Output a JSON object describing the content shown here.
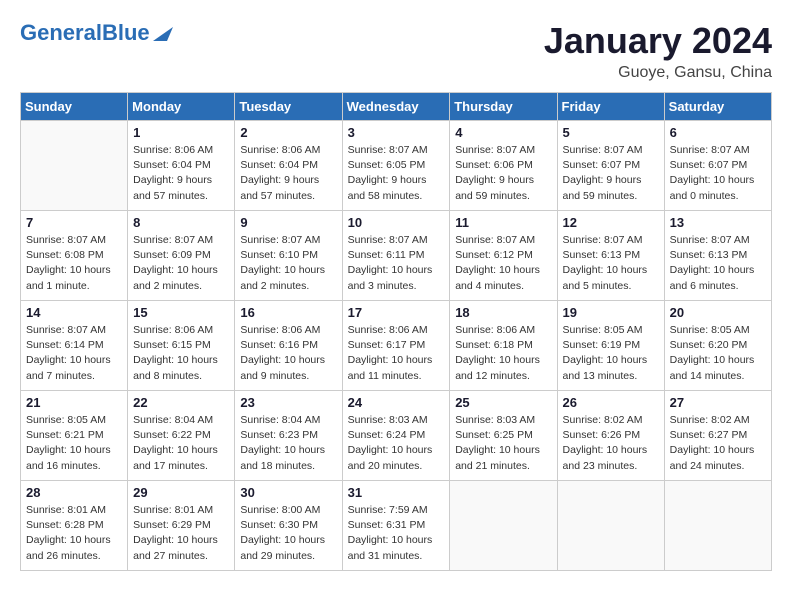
{
  "header": {
    "logo_text_regular": "General",
    "logo_text_blue": "Blue",
    "month_title": "January 2024",
    "location": "Guoye, Gansu, China"
  },
  "days_of_week": [
    "Sunday",
    "Monday",
    "Tuesday",
    "Wednesday",
    "Thursday",
    "Friday",
    "Saturday"
  ],
  "weeks": [
    [
      {
        "day": "",
        "info": ""
      },
      {
        "day": "1",
        "info": "Sunrise: 8:06 AM\nSunset: 6:04 PM\nDaylight: 9 hours\nand 57 minutes."
      },
      {
        "day": "2",
        "info": "Sunrise: 8:06 AM\nSunset: 6:04 PM\nDaylight: 9 hours\nand 57 minutes."
      },
      {
        "day": "3",
        "info": "Sunrise: 8:07 AM\nSunset: 6:05 PM\nDaylight: 9 hours\nand 58 minutes."
      },
      {
        "day": "4",
        "info": "Sunrise: 8:07 AM\nSunset: 6:06 PM\nDaylight: 9 hours\nand 59 minutes."
      },
      {
        "day": "5",
        "info": "Sunrise: 8:07 AM\nSunset: 6:07 PM\nDaylight: 9 hours\nand 59 minutes."
      },
      {
        "day": "6",
        "info": "Sunrise: 8:07 AM\nSunset: 6:07 PM\nDaylight: 10 hours\nand 0 minutes."
      }
    ],
    [
      {
        "day": "7",
        "info": "Sunrise: 8:07 AM\nSunset: 6:08 PM\nDaylight: 10 hours\nand 1 minute."
      },
      {
        "day": "8",
        "info": "Sunrise: 8:07 AM\nSunset: 6:09 PM\nDaylight: 10 hours\nand 2 minutes."
      },
      {
        "day": "9",
        "info": "Sunrise: 8:07 AM\nSunset: 6:10 PM\nDaylight: 10 hours\nand 2 minutes."
      },
      {
        "day": "10",
        "info": "Sunrise: 8:07 AM\nSunset: 6:11 PM\nDaylight: 10 hours\nand 3 minutes."
      },
      {
        "day": "11",
        "info": "Sunrise: 8:07 AM\nSunset: 6:12 PM\nDaylight: 10 hours\nand 4 minutes."
      },
      {
        "day": "12",
        "info": "Sunrise: 8:07 AM\nSunset: 6:13 PM\nDaylight: 10 hours\nand 5 minutes."
      },
      {
        "day": "13",
        "info": "Sunrise: 8:07 AM\nSunset: 6:13 PM\nDaylight: 10 hours\nand 6 minutes."
      }
    ],
    [
      {
        "day": "14",
        "info": "Sunrise: 8:07 AM\nSunset: 6:14 PM\nDaylight: 10 hours\nand 7 minutes."
      },
      {
        "day": "15",
        "info": "Sunrise: 8:06 AM\nSunset: 6:15 PM\nDaylight: 10 hours\nand 8 minutes."
      },
      {
        "day": "16",
        "info": "Sunrise: 8:06 AM\nSunset: 6:16 PM\nDaylight: 10 hours\nand 9 minutes."
      },
      {
        "day": "17",
        "info": "Sunrise: 8:06 AM\nSunset: 6:17 PM\nDaylight: 10 hours\nand 11 minutes."
      },
      {
        "day": "18",
        "info": "Sunrise: 8:06 AM\nSunset: 6:18 PM\nDaylight: 10 hours\nand 12 minutes."
      },
      {
        "day": "19",
        "info": "Sunrise: 8:05 AM\nSunset: 6:19 PM\nDaylight: 10 hours\nand 13 minutes."
      },
      {
        "day": "20",
        "info": "Sunrise: 8:05 AM\nSunset: 6:20 PM\nDaylight: 10 hours\nand 14 minutes."
      }
    ],
    [
      {
        "day": "21",
        "info": "Sunrise: 8:05 AM\nSunset: 6:21 PM\nDaylight: 10 hours\nand 16 minutes."
      },
      {
        "day": "22",
        "info": "Sunrise: 8:04 AM\nSunset: 6:22 PM\nDaylight: 10 hours\nand 17 minutes."
      },
      {
        "day": "23",
        "info": "Sunrise: 8:04 AM\nSunset: 6:23 PM\nDaylight: 10 hours\nand 18 minutes."
      },
      {
        "day": "24",
        "info": "Sunrise: 8:03 AM\nSunset: 6:24 PM\nDaylight: 10 hours\nand 20 minutes."
      },
      {
        "day": "25",
        "info": "Sunrise: 8:03 AM\nSunset: 6:25 PM\nDaylight: 10 hours\nand 21 minutes."
      },
      {
        "day": "26",
        "info": "Sunrise: 8:02 AM\nSunset: 6:26 PM\nDaylight: 10 hours\nand 23 minutes."
      },
      {
        "day": "27",
        "info": "Sunrise: 8:02 AM\nSunset: 6:27 PM\nDaylight: 10 hours\nand 24 minutes."
      }
    ],
    [
      {
        "day": "28",
        "info": "Sunrise: 8:01 AM\nSunset: 6:28 PM\nDaylight: 10 hours\nand 26 minutes."
      },
      {
        "day": "29",
        "info": "Sunrise: 8:01 AM\nSunset: 6:29 PM\nDaylight: 10 hours\nand 27 minutes."
      },
      {
        "day": "30",
        "info": "Sunrise: 8:00 AM\nSunset: 6:30 PM\nDaylight: 10 hours\nand 29 minutes."
      },
      {
        "day": "31",
        "info": "Sunrise: 7:59 AM\nSunset: 6:31 PM\nDaylight: 10 hours\nand 31 minutes."
      },
      {
        "day": "",
        "info": ""
      },
      {
        "day": "",
        "info": ""
      },
      {
        "day": "",
        "info": ""
      }
    ]
  ]
}
